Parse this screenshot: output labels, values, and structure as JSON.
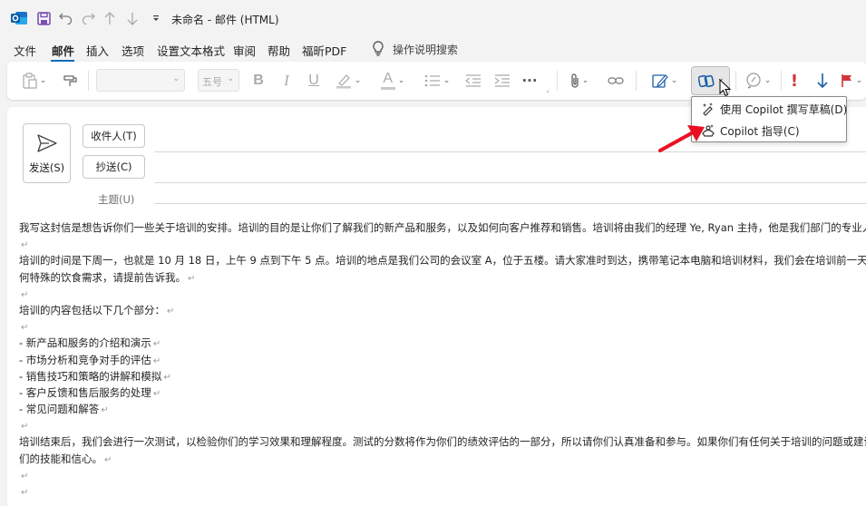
{
  "titlebar": {
    "title": "未命名  -  邮件 (HTML)",
    "quick_access": [
      "save-icon",
      "undo-icon",
      "redo-icon",
      "up-arrow-icon",
      "down-arrow-icon",
      "customize-icon"
    ]
  },
  "menu": {
    "items": [
      "文件",
      "邮件",
      "插入",
      "选项",
      "设置文本格式",
      "审阅",
      "帮助",
      "福昕PDF"
    ],
    "active": "邮件",
    "search_label": "操作说明搜索"
  },
  "ribbon": {
    "font_size_value": "五号",
    "bold": "B",
    "italic": "I",
    "underline": "U",
    "font_color_letter": "A",
    "more": "···",
    "importance_high": "!"
  },
  "dropdown": {
    "items": [
      {
        "label": "使用 Copilot 撰写草稿(D)",
        "icon": "copilot-draft-icon"
      },
      {
        "label": "Copilot 指导(C)",
        "icon": "copilot-coach-icon"
      }
    ]
  },
  "compose": {
    "send_label": "发送(S)",
    "to_label": "收件人(T)",
    "cc_label": "抄送(C)",
    "subject_label": "主题(U)"
  },
  "body": {
    "lines": [
      "我写这封信是想告诉你们一些关于培训的安排。培训的目的是让你们了解我们的新产品和服务，以及如何向客户推荐和销售。培训将由我们的经理 Ye, Ryan 主持，他是我们部门的专业人",
      "",
      "培训的时间是下周一，也就是 10 月 18 日，上午 9 点到下午 5 点。培训的地点是我们公司的会议室 A，位于五楼。请大家准时到达，携带笔记本电脑和培训材料，我们会在培训前一天发给",
      "何特殊的饮食需求，请提前告诉我。",
      "",
      "培训的内容包括以下几个部分：",
      "",
      "- 新产品和服务的介绍和演示",
      "- 市场分析和竞争对手的评估",
      "- 销售技巧和策略的讲解和模拟",
      "- 客户反馈和售后服务的处理",
      "- 常见问题和解答",
      "",
      "培训结束后，我们会进行一次测试，以检验你们的学习效果和理解程度。测试的分数将作为你们的绩效评估的一部分，所以请你们认真准备和参与。如果你们有任何关于培训的问题或建议",
      "们的技能和信心。",
      "",
      ""
    ],
    "paragraph_mark": "↵"
  }
}
